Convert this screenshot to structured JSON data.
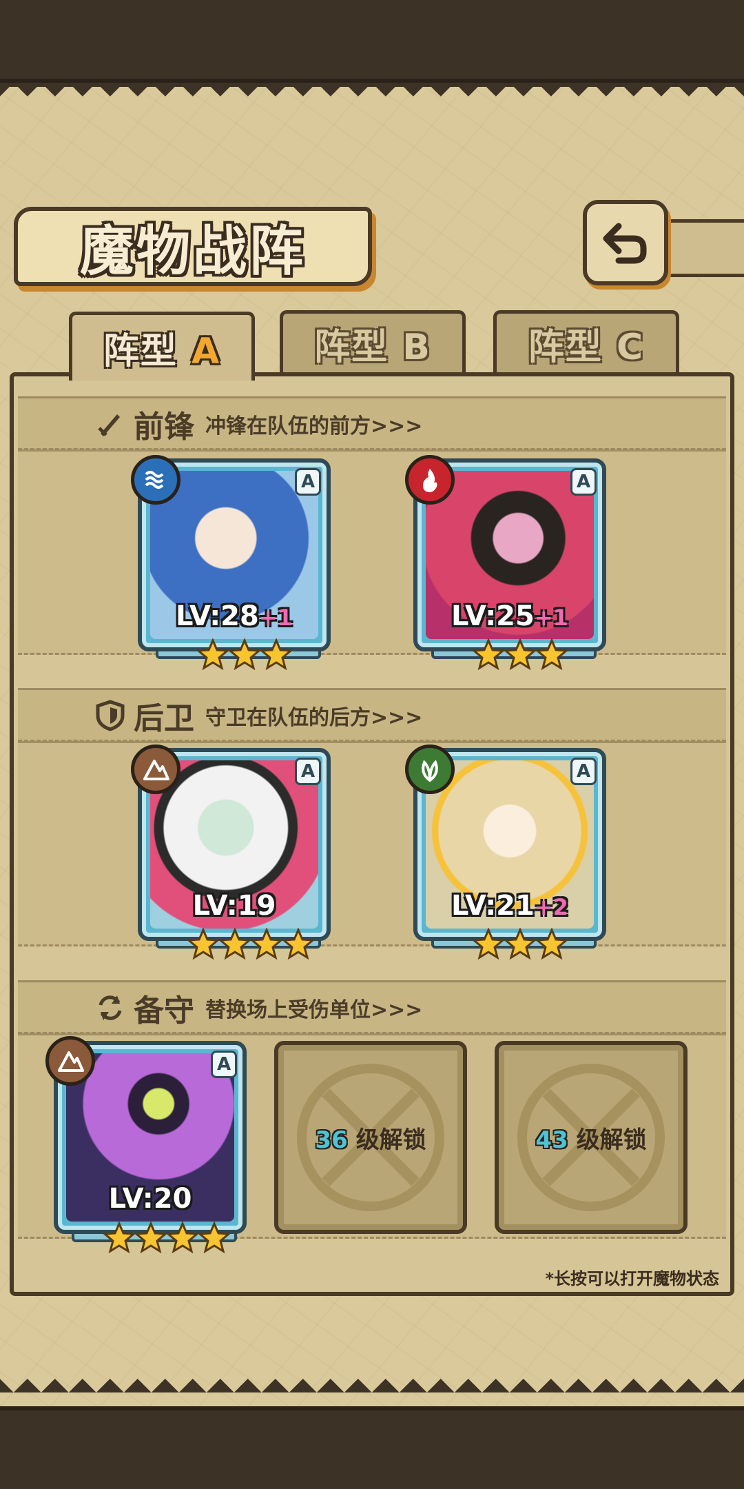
{
  "page": {
    "title": "魔物战阵"
  },
  "tabs": [
    {
      "label": "阵型",
      "suffix": "A",
      "active": true
    },
    {
      "label": "阵型",
      "suffix": "B",
      "active": false
    },
    {
      "label": "阵型",
      "suffix": "C",
      "active": false
    }
  ],
  "sections": {
    "front": {
      "title": "前锋",
      "desc": "冲锋在队伍的前方>>>"
    },
    "rear": {
      "title": "后卫",
      "desc": "守卫在队伍的后方>>>"
    },
    "reserve": {
      "title": "备守",
      "desc": "替换场上受伤单位>>>"
    }
  },
  "cards": [
    {
      "element": "water",
      "rank": "A",
      "level": "LV:28",
      "bonus": "+1",
      "stars": 3,
      "color": "#4a86d6"
    },
    {
      "element": "fire",
      "rank": "A",
      "level": "LV:25",
      "bonus": "+1",
      "stars": 3,
      "color": "#d9456a"
    },
    {
      "element": "earth",
      "rank": "A",
      "level": "LV:19",
      "bonus": "",
      "stars": 4,
      "color": "#8fc7a8"
    },
    {
      "element": "wood",
      "rank": "A",
      "level": "LV:21",
      "bonus": "+2",
      "stars": 3,
      "color": "#e6d7a6"
    },
    {
      "element": "earth",
      "rank": "A",
      "level": "LV:20",
      "bonus": "",
      "stars": 4,
      "color": "#3b2f62"
    }
  ],
  "locked_slots": [
    {
      "level": "36",
      "text": "级解锁"
    },
    {
      "level": "43",
      "text": "级解锁"
    }
  ],
  "footer": {
    "note": "*长按可以打开魔物状态"
  },
  "colors": {
    "accent": "#f2a830",
    "panel": "#d6c596",
    "border": "#4a3a26"
  }
}
